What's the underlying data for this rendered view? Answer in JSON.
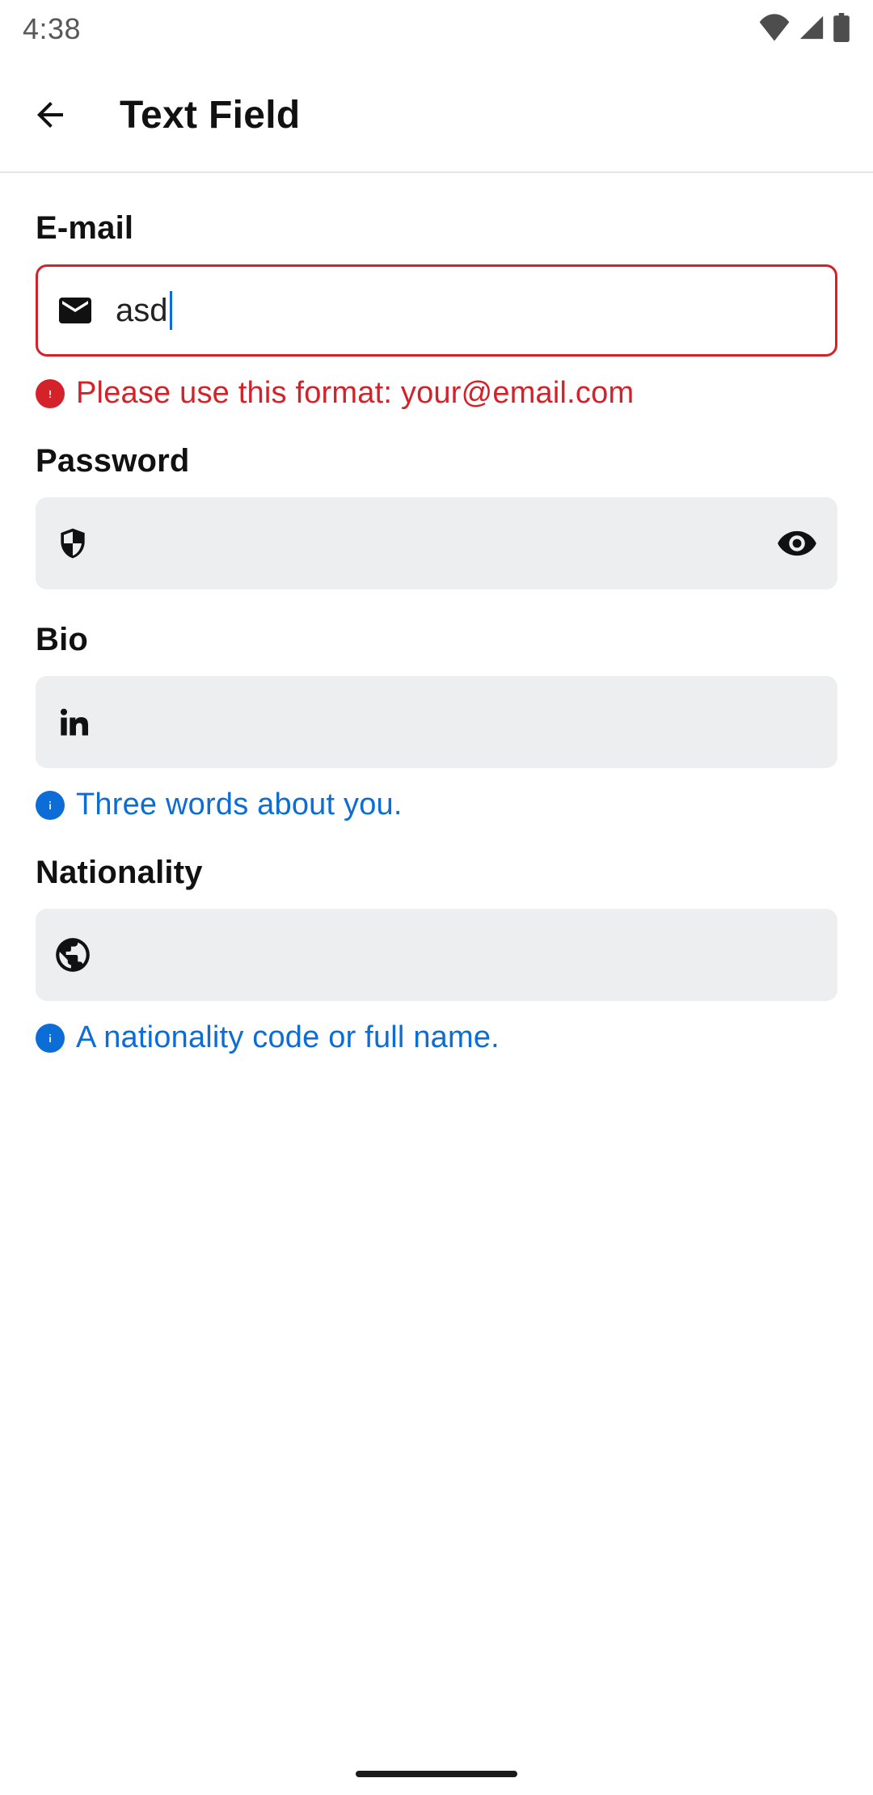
{
  "statusbar": {
    "clock": "4:38"
  },
  "appbar": {
    "title": "Text Field"
  },
  "fields": {
    "email": {
      "label": "E-mail",
      "value": "asd",
      "error": "Please use this format: your@email.com"
    },
    "password": {
      "label": "Password",
      "value": ""
    },
    "bio": {
      "label": "Bio",
      "value": "",
      "hint": "Three words about you."
    },
    "nationality": {
      "label": "Nationality",
      "value": "",
      "hint": "A nationality code or full name."
    }
  }
}
